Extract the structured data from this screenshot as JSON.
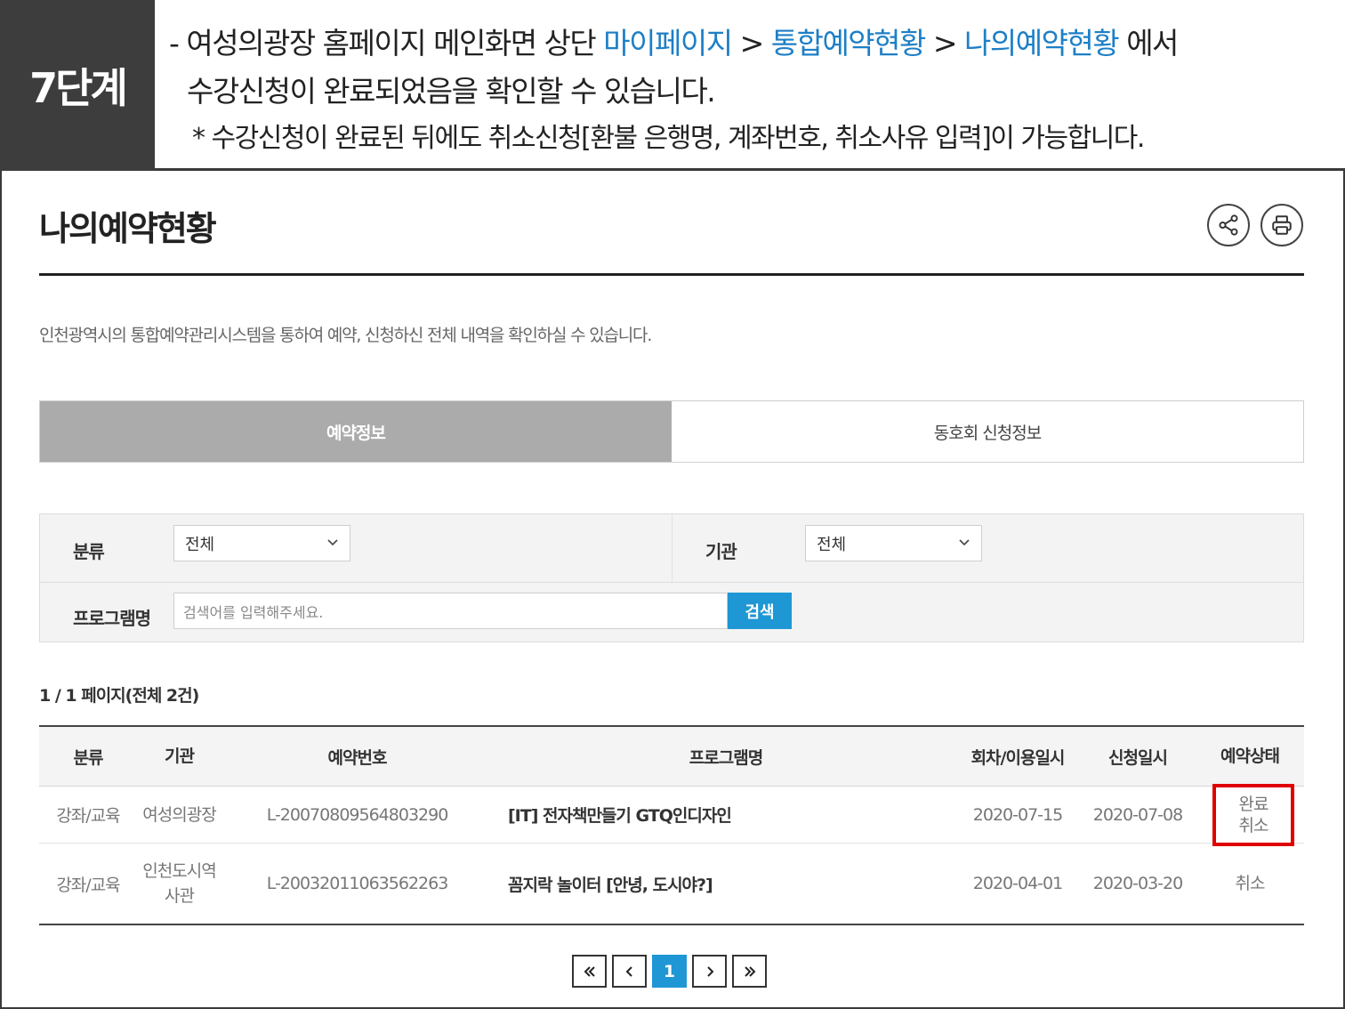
{
  "banner": {
    "step": "7단계",
    "line1_prefix": "- 여성의광장 홈페이지 메인화면 상단 ",
    "path1": "마이페이지",
    "sep1": " > ",
    "path2": "통합예약현황",
    "sep2": " > ",
    "path3": "나의예약현황",
    "line1_suffix": " 에서",
    "line2": "수강신청이 완료되었음을 확인할 수 있습니다.",
    "note": "* 수강신청이 완료된 뒤에도 취소신청[환불 은행명, 계좌번호, 취소사유 입력]이 가능합니다."
  },
  "page": {
    "title": "나의예약현황",
    "description": "인천광역시의 통합예약관리시스템을 통하여 예약, 신청하신 전체 내역을 확인하실 수 있습니다.",
    "share_icon": "share-icon",
    "print_icon": "print-icon"
  },
  "tabs": [
    {
      "label": "예약정보",
      "active": true
    },
    {
      "label": "동호회 신청정보",
      "active": false
    }
  ],
  "filter": {
    "category_label": "분류",
    "category_value": "전체",
    "org_label": "기관",
    "org_value": "전체",
    "program_label": "프로그램명",
    "search_placeholder": "검색어를 입력해주세요.",
    "search_button": "검색"
  },
  "page_count": "1 / 1 페이지(전체 2건)",
  "table": {
    "headers": [
      "분류",
      "기관",
      "예약번호",
      "프로그램명",
      "회차/이용일시",
      "신청일시",
      "예약상태"
    ],
    "rows": [
      {
        "category": "강좌/교육",
        "org": "여성의광장",
        "reservation_no": "L-20070809564803290",
        "program": "[IT] 전자책만들기 GTQ인디자인",
        "use_date": "2020-07-15",
        "apply_date": "2020-07-08",
        "status_line1": "완료",
        "status_line2": "취소"
      },
      {
        "category": "강좌/교육",
        "org_line1": "인천도시역",
        "org_line2": "사관",
        "reservation_no": "L-20032011063562263",
        "program": "꼼지락 놀이터 [안녕, 도시야?]",
        "use_date": "2020-04-01",
        "apply_date": "2020-03-20",
        "status": "취소"
      }
    ]
  },
  "pager": {
    "first_icon": "double-chevron-left-icon",
    "prev_icon": "chevron-left-icon",
    "current": "1",
    "next_icon": "chevron-right-icon",
    "last_icon": "double-chevron-right-icon"
  },
  "colors": {
    "accent": "#1f97d4",
    "highlight_text": "#1d7fc6",
    "step_bg": "#3d3d3d",
    "active_tab": "#ababab",
    "emphasis_box": "#e00000"
  }
}
